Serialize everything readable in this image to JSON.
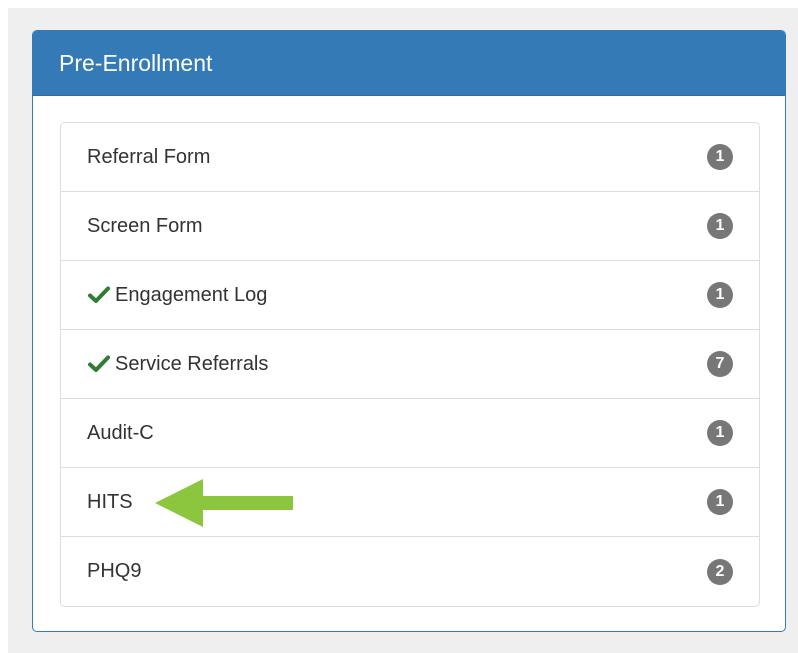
{
  "panel": {
    "title": "Pre-Enrollment"
  },
  "items": [
    {
      "label": "Referral Form",
      "count": "1",
      "completed": false
    },
    {
      "label": "Screen Form",
      "count": "1",
      "completed": false
    },
    {
      "label": "Engagement Log",
      "count": "1",
      "completed": true
    },
    {
      "label": "Service Referrals",
      "count": "7",
      "completed": true
    },
    {
      "label": "Audit-C",
      "count": "1",
      "completed": false
    },
    {
      "label": "HITS",
      "count": "1",
      "completed": false
    },
    {
      "label": "PHQ9",
      "count": "2",
      "completed": false
    }
  ],
  "annotation": {
    "arrow_target": "HITS",
    "arrow_color": "#8cc63f"
  },
  "colors": {
    "panel_primary": "#337ab7",
    "badge": "#777777",
    "check": "#2e7d32"
  }
}
